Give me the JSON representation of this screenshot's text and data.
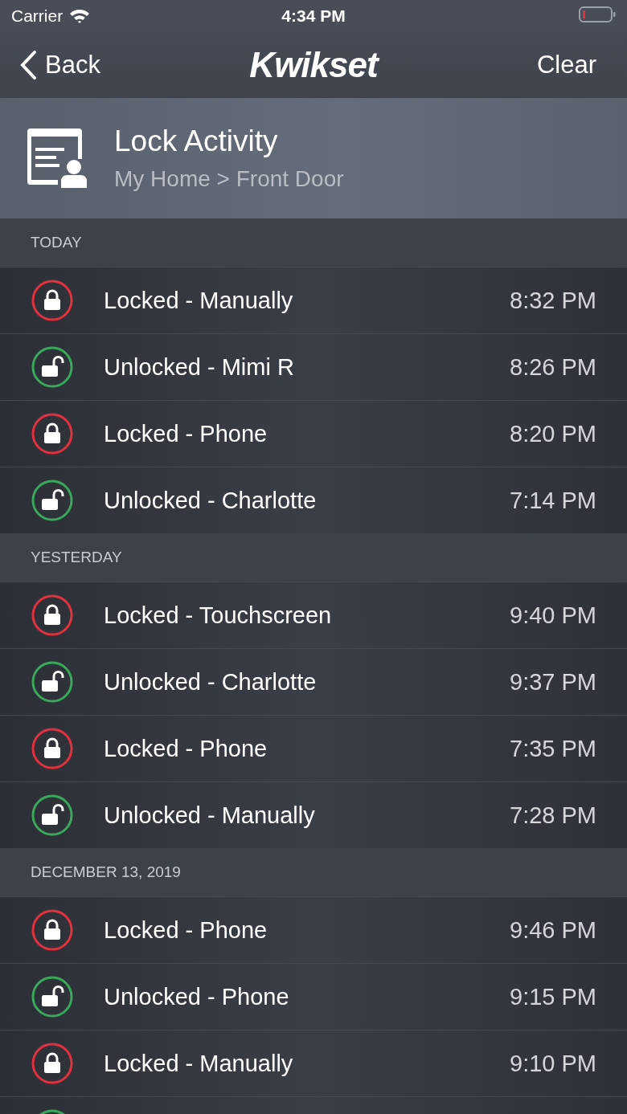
{
  "status_bar": {
    "carrier": "Carrier",
    "time": "4:34 PM"
  },
  "nav": {
    "back": "Back",
    "logo": "Kwikset",
    "action": "Clear"
  },
  "header": {
    "title": "Lock Activity",
    "breadcrumb": "My Home > Front Door"
  },
  "sections": [
    {
      "title": "TODAY",
      "events": [
        {
          "kind": "locked",
          "label": "Locked - Manually",
          "time": "8:32 PM"
        },
        {
          "kind": "unlocked",
          "label": "Unlocked - Mimi R",
          "time": "8:26 PM"
        },
        {
          "kind": "locked",
          "label": "Locked - Phone",
          "time": "8:20 PM"
        },
        {
          "kind": "unlocked",
          "label": "Unlocked - Charlotte",
          "time": "7:14 PM"
        }
      ]
    },
    {
      "title": "YESTERDAY",
      "events": [
        {
          "kind": "locked",
          "label": "Locked - Touchscreen",
          "time": "9:40 PM"
        },
        {
          "kind": "unlocked",
          "label": "Unlocked - Charlotte",
          "time": "9:37 PM"
        },
        {
          "kind": "locked",
          "label": "Locked - Phone",
          "time": "7:35 PM"
        },
        {
          "kind": "unlocked",
          "label": "Unlocked - Manually",
          "time": "7:28 PM"
        }
      ]
    },
    {
      "title": "DECEMBER 13, 2019",
      "events": [
        {
          "kind": "locked",
          "label": "Locked - Phone",
          "time": "9:46 PM"
        },
        {
          "kind": "unlocked",
          "label": "Unlocked - Phone",
          "time": "9:15 PM"
        },
        {
          "kind": "locked",
          "label": "Locked - Manually",
          "time": "9:10 PM"
        },
        {
          "kind": "unlocked"
        }
      ]
    }
  ]
}
